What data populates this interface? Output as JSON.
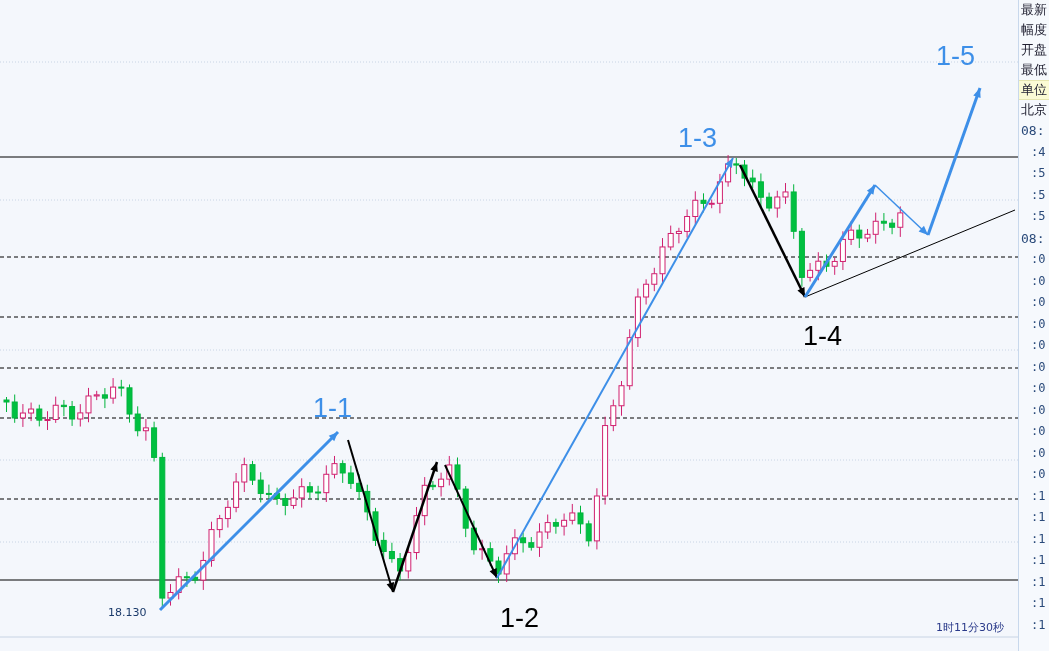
{
  "chart_labels": [
    {
      "text": "1-1",
      "color": "#3d8fe8"
    },
    {
      "text": "1-2",
      "color": "#000000"
    },
    {
      "text": "1-3",
      "color": "#3d8fe8"
    },
    {
      "text": "1-4",
      "color": "#000000"
    },
    {
      "text": "1-5",
      "color": "#3d8fe8"
    }
  ],
  "low_price_label": "18.130",
  "countdown": "1时11分30秒",
  "side_panel": {
    "info_rows": [
      {
        "text": "最新",
        "highlighted": false
      },
      {
        "text": "幅度",
        "highlighted": false
      },
      {
        "text": "开盘",
        "highlighted": false
      },
      {
        "text": "最低",
        "highlighted": false
      },
      {
        "text": "单位",
        "highlighted": true
      },
      {
        "text": "北京",
        "highlighted": false
      }
    ],
    "time_rows": [
      "08:",
      ":4",
      ":5",
      ":5",
      ":5",
      "08:",
      ":0",
      ":0",
      ":0",
      ":0",
      ":0",
      ":0",
      ":0",
      ":0",
      ":0",
      ":0",
      ":0",
      ":1",
      ":1",
      ":1",
      ":1",
      ":1",
      ":1",
      ":1"
    ]
  }
}
